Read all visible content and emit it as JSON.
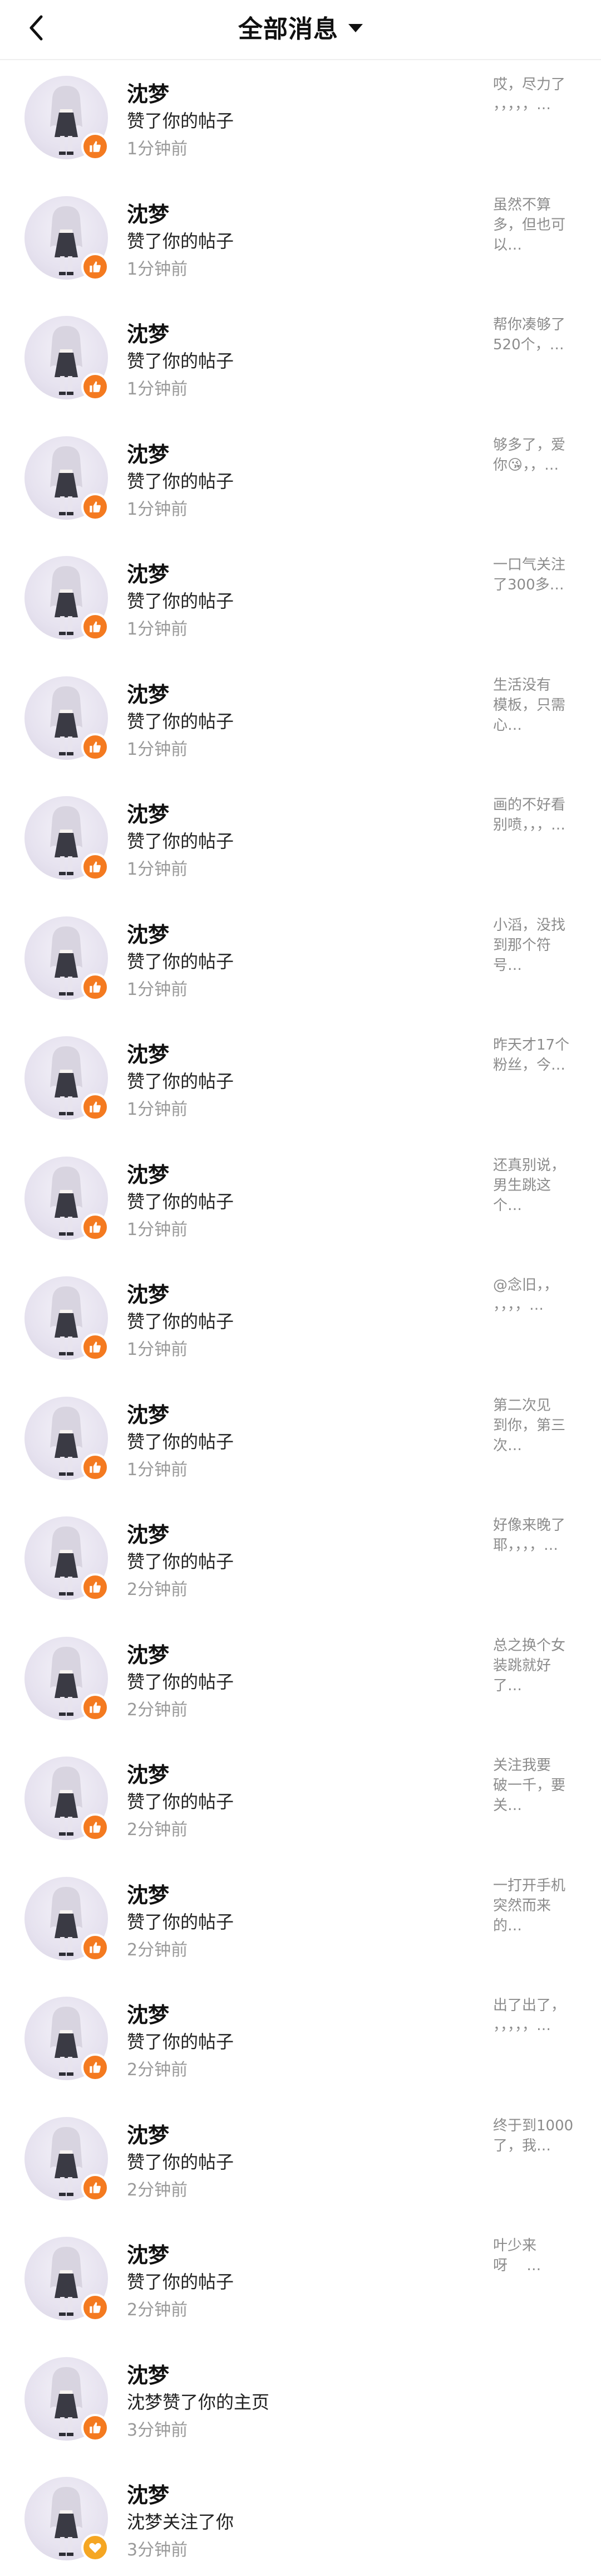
{
  "header": {
    "title": "全部消息",
    "back_icon": "chevron-left-icon",
    "dropdown_icon": "caret-down-icon"
  },
  "colors": {
    "like_badge": "#f47a20",
    "follow_badge": "#f5a623",
    "title": "#111111",
    "time": "#9a9a9a",
    "preview": "#8c8c8c"
  },
  "notifications": [
    {
      "name": "沈梦",
      "action": "赞了你的帖子",
      "time": "1分钟前",
      "badge": "thumbs-up-icon",
      "preview": "哎，尽力了\n，，，，，…"
    },
    {
      "name": "沈梦",
      "action": "赞了你的帖子",
      "time": "1分钟前",
      "badge": "thumbs-up-icon",
      "preview": "虽然不算\n多，但也可\n以…"
    },
    {
      "name": "沈梦",
      "action": "赞了你的帖子",
      "time": "1分钟前",
      "badge": "thumbs-up-icon",
      "preview": "帮你凑够了\n520个，…"
    },
    {
      "name": "沈梦",
      "action": "赞了你的帖子",
      "time": "1分钟前",
      "badge": "thumbs-up-icon",
      "preview": "够多了，爱\n你😘，，…"
    },
    {
      "name": "沈梦",
      "action": "赞了你的帖子",
      "time": "1分钟前",
      "badge": "thumbs-up-icon",
      "preview": "一口气关注\n了300多…"
    },
    {
      "name": "沈梦",
      "action": "赞了你的帖子",
      "time": "1分钟前",
      "badge": "thumbs-up-icon",
      "preview": "生活没有\n模板，只需\n心…"
    },
    {
      "name": "沈梦",
      "action": "赞了你的帖子",
      "time": "1分钟前",
      "badge": "thumbs-up-icon",
      "preview": "画的不好看\n别喷，，，…"
    },
    {
      "name": "沈梦",
      "action": "赞了你的帖子",
      "time": "1分钟前",
      "badge": "thumbs-up-icon",
      "preview": "小滔，没找\n到那个符\n号…"
    },
    {
      "name": "沈梦",
      "action": "赞了你的帖子",
      "time": "1分钟前",
      "badge": "thumbs-up-icon",
      "preview": "昨天才17个\n粉丝，今…"
    },
    {
      "name": "沈梦",
      "action": "赞了你的帖子",
      "time": "1分钟前",
      "badge": "thumbs-up-icon",
      "preview": "还真别说，\n男生跳这\n个…"
    },
    {
      "name": "沈梦",
      "action": "赞了你的帖子",
      "time": "1分钟前",
      "badge": "thumbs-up-icon",
      "preview": "@念旧，，\n，，，，…"
    },
    {
      "name": "沈梦",
      "action": "赞了你的帖子",
      "time": "1分钟前",
      "badge": "thumbs-up-icon",
      "preview": "第二次见\n到你，第三\n次…"
    },
    {
      "name": "沈梦",
      "action": "赞了你的帖子",
      "time": "2分钟前",
      "badge": "thumbs-up-icon",
      "preview": "好像来晚了\n耶，，，，…"
    },
    {
      "name": "沈梦",
      "action": "赞了你的帖子",
      "time": "2分钟前",
      "badge": "thumbs-up-icon",
      "preview": "总之换个女\n装跳就好\n了…"
    },
    {
      "name": "沈梦",
      "action": "赞了你的帖子",
      "time": "2分钟前",
      "badge": "thumbs-up-icon",
      "preview": "关注我要\n破一千，要\n关…"
    },
    {
      "name": "沈梦",
      "action": "赞了你的帖子",
      "time": "2分钟前",
      "badge": "thumbs-up-icon",
      "preview": "一打开手机\n突然而来\n的…"
    },
    {
      "name": "沈梦",
      "action": "赞了你的帖子",
      "time": "2分钟前",
      "badge": "thumbs-up-icon",
      "preview": "出了出了，\n，，，，，…"
    },
    {
      "name": "沈梦",
      "action": "赞了你的帖子",
      "time": "2分钟前",
      "badge": "thumbs-up-icon",
      "preview": "终于到1000\n了，我…"
    },
    {
      "name": "沈梦",
      "action": "赞了你的帖子",
      "time": "2分钟前",
      "badge": "thumbs-up-icon",
      "preview": "叶少来\n呀　 …"
    },
    {
      "name": "沈梦",
      "action": "沈梦赞了你的主页",
      "time": "3分钟前",
      "badge": "thumbs-up-icon",
      "preview": ""
    },
    {
      "name": "沈梦",
      "action": "沈梦关注了你",
      "time": "3分钟前",
      "badge": "heart-icon",
      "preview": ""
    }
  ]
}
